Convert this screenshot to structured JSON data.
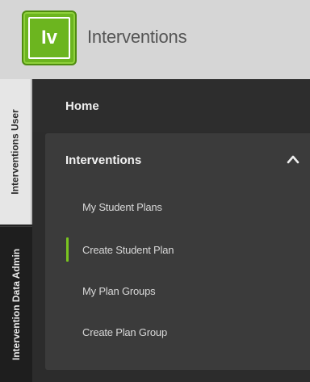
{
  "header": {
    "logo_text": "Iv",
    "app_title": "Interventions"
  },
  "side_tabs": [
    {
      "label": "Interventions User",
      "active": true
    },
    {
      "label": "Intervention Data Admin",
      "active": false
    }
  ],
  "nav": {
    "home_label": "Home",
    "section": {
      "label": "Interventions",
      "expanded": true,
      "items": [
        {
          "label": "My Student Plans",
          "active": false
        },
        {
          "label": "Create Student Plan",
          "active": true
        },
        {
          "label": "My Plan Groups",
          "active": false
        },
        {
          "label": "Create Plan Group",
          "active": false
        }
      ]
    }
  },
  "colors": {
    "accent_green": "#6cb51f",
    "active_indicator": "#7ac520",
    "header_bg": "#d6d6d6",
    "nav_bg": "#2c2c2c",
    "section_bg": "#3b3b3b"
  },
  "icons": {
    "section_toggle": "chevron-up-icon"
  }
}
